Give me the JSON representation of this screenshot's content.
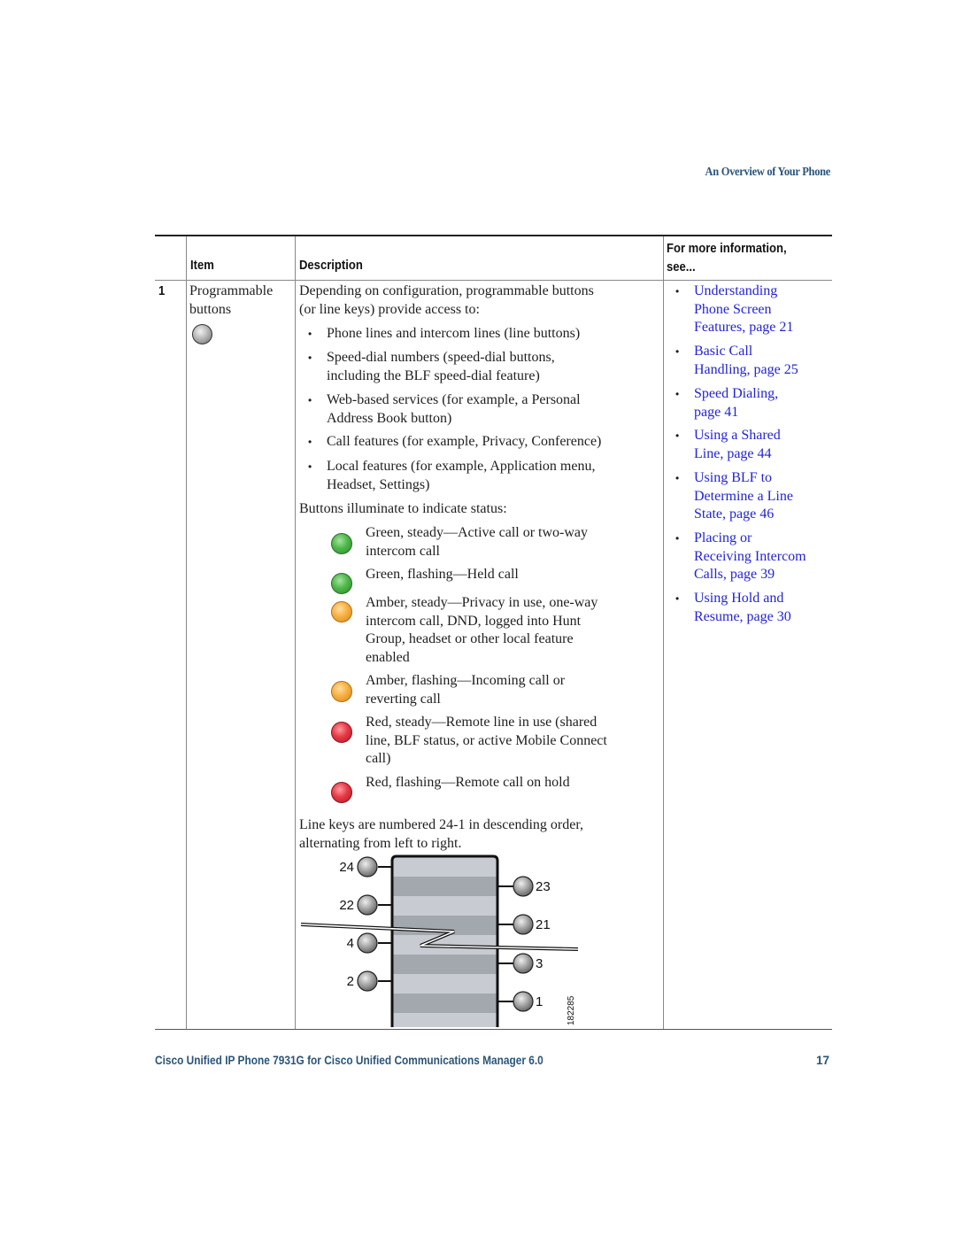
{
  "running_head": "An Overview of Your Phone",
  "table": {
    "headers": {
      "item": "Item",
      "description": "Description",
      "more_info_line1": "For more information,",
      "more_info_line2": "see..."
    },
    "row": {
      "number": "1",
      "item_line1": "Programmable",
      "item_line2": "buttons",
      "item_icon": "gray-button-icon",
      "description": {
        "intro_line1": "Depending on configuration, programmable buttons",
        "intro_line2": "(or line keys) provide access to:",
        "bullets": [
          {
            "line1": "Phone lines and intercom lines (line buttons)"
          },
          {
            "line1": "Speed-dial numbers (speed-dial buttons,",
            "line2": "including the BLF speed-dial feature)"
          },
          {
            "line1": "Web-based services (for example, a Personal",
            "line2": "Address Book button)"
          },
          {
            "line1": "Call features (for example, Privacy, Conference)"
          },
          {
            "line1": "Local features (for example, Application menu,",
            "line2": "Headset, Settings)"
          }
        ],
        "status_intro": "Buttons illuminate to indicate status:",
        "status_items": [
          {
            "color": "green",
            "icon": "green-led-icon",
            "lines": [
              "Green, steady—Active call or two-way",
              "intercom call"
            ]
          },
          {
            "color": "green",
            "icon": "green-led-icon",
            "lines": [
              "Green, flashing—Held call"
            ]
          },
          {
            "color": "amber",
            "icon": "amber-led-icon",
            "lines": [
              "Amber, steady—Privacy in use, one-way",
              "intercom call, DND, logged into Hunt",
              "Group, headset or other local feature",
              "enabled"
            ]
          },
          {
            "color": "amber",
            "icon": "amber-led-icon",
            "lines": [
              "Amber, flashing—Incoming call or",
              "reverting call"
            ]
          },
          {
            "color": "red",
            "icon": "red-led-icon",
            "lines": [
              "Red, steady—Remote line in use (shared",
              "line, BLF status, or active Mobile Connect",
              "call)"
            ]
          },
          {
            "color": "red",
            "icon": "red-led-icon",
            "lines": [
              "Red, flashing—Remote call on hold"
            ]
          }
        ],
        "line_keys_line1": "Line keys are numbered 24-1 in descending order,",
        "line_keys_line2": "alternating from left to right.",
        "diagram": {
          "left_keys": [
            "24",
            "22",
            "4",
            "2"
          ],
          "right_keys": [
            "23",
            "21",
            "3",
            "1"
          ],
          "figure_id": "182285"
        }
      },
      "links": [
        {
          "lines": [
            "Understanding",
            "Phone Screen",
            "Features, page 21"
          ]
        },
        {
          "lines": [
            "Basic Call",
            "Handling, page 25"
          ]
        },
        {
          "lines": [
            "Speed Dialing,",
            "page 41"
          ]
        },
        {
          "lines": [
            "Using a Shared",
            "Line, page 44"
          ]
        },
        {
          "lines": [
            "Using BLF to",
            "Determine a Line",
            "State, page 46"
          ]
        },
        {
          "lines": [
            "Placing or",
            "Receiving Intercom",
            "Calls, page 39"
          ]
        },
        {
          "lines": [
            "Using Hold and",
            "Resume, page 30"
          ]
        }
      ]
    }
  },
  "footer": {
    "title": "Cisco Unified IP Phone 7931G for Cisco Unified Communications Manager 6.0",
    "page_number": "17"
  },
  "colors": {
    "heading_blue": "#2b5478",
    "link_blue": "#2323d6"
  }
}
